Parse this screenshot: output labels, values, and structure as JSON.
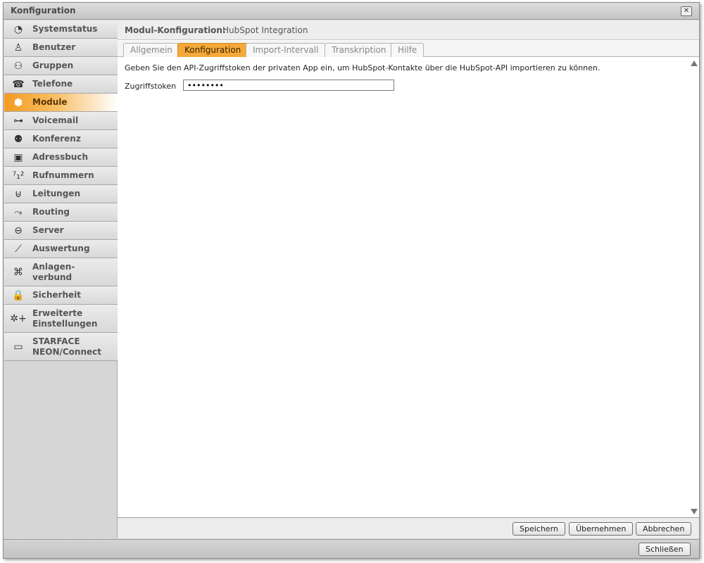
{
  "window": {
    "title": "Konfiguration",
    "close_icon": "close-icon"
  },
  "sidebar": {
    "items": [
      {
        "id": "systemstatus",
        "label": "Systemstatus",
        "icon": "◔",
        "active": false,
        "tall": false
      },
      {
        "id": "benutzer",
        "label": "Benutzer",
        "icon": "♙",
        "active": false,
        "tall": false
      },
      {
        "id": "gruppen",
        "label": "Gruppen",
        "icon": "⚇",
        "active": false,
        "tall": false
      },
      {
        "id": "telefone",
        "label": "Telefone",
        "icon": "☎",
        "active": false,
        "tall": false
      },
      {
        "id": "module",
        "label": "Module",
        "icon": "⬢",
        "active": true,
        "tall": false
      },
      {
        "id": "voicemail",
        "label": "Voicemail",
        "icon": "⊶",
        "active": false,
        "tall": false
      },
      {
        "id": "konferenz",
        "label": "Konferenz",
        "icon": "⚉",
        "active": false,
        "tall": false
      },
      {
        "id": "adressbuch",
        "label": "Adressbuch",
        "icon": "▣",
        "active": false,
        "tall": false
      },
      {
        "id": "rufnummern",
        "label": "Rufnummern",
        "icon": "⁷₁²",
        "active": false,
        "tall": false
      },
      {
        "id": "leitungen",
        "label": "Leitungen",
        "icon": "⊎",
        "active": false,
        "tall": false
      },
      {
        "id": "routing",
        "label": "Routing",
        "icon": "⤳",
        "active": false,
        "tall": false
      },
      {
        "id": "server",
        "label": "Server",
        "icon": "⊖",
        "active": false,
        "tall": false
      },
      {
        "id": "auswertung",
        "label": "Auswertung",
        "icon": "⟋",
        "active": false,
        "tall": false
      },
      {
        "id": "anlagenverbund",
        "label": "Anlagen-\nverbund",
        "icon": "⌘",
        "active": false,
        "tall": true
      },
      {
        "id": "sicherheit",
        "label": "Sicherheit",
        "icon": "🔒",
        "active": false,
        "tall": false
      },
      {
        "id": "erweiterte",
        "label": "Erweiterte\nEinstellungen",
        "icon": "✲+",
        "active": false,
        "tall": true
      },
      {
        "id": "starface",
        "label": "STARFACE\nNEON/Connect",
        "icon": "▭",
        "active": false,
        "tall": true
      }
    ]
  },
  "header": {
    "label": "Modul-Konfiguration:",
    "value": "HubSpot Integration"
  },
  "tabs": [
    {
      "label": "Allgemein",
      "active": false
    },
    {
      "label": "Konfiguration",
      "active": true
    },
    {
      "label": "Import-Intervall",
      "active": false
    },
    {
      "label": "Transkription",
      "active": false
    },
    {
      "label": "Hilfe",
      "active": false
    }
  ],
  "form": {
    "description": "Geben Sie den API-Zugriffstoken der privaten App ein, um HubSpot-Kontakte über die HubSpot-API importieren zu können.",
    "token_label": "Zugriffstoken",
    "token_value": "••••••••"
  },
  "footer": {
    "save": "Speichern",
    "apply": "Übernehmen",
    "cancel": "Abbrechen"
  },
  "bottom": {
    "close": "Schließen"
  },
  "colors": {
    "accent": "#f5a93a"
  }
}
